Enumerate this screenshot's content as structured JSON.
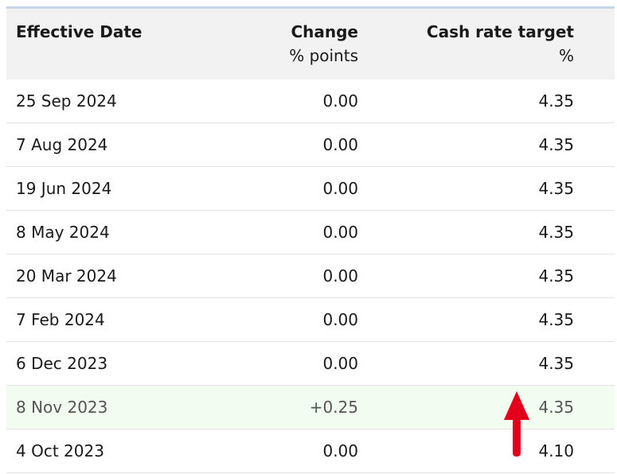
{
  "table": {
    "headers": {
      "date": "Effective Date",
      "change": "Change",
      "change_unit": "% points",
      "rate": "Cash rate target",
      "rate_unit": "%"
    },
    "rows": [
      {
        "date": "25 Sep 2024",
        "change": "0.00",
        "rate": "4.35"
      },
      {
        "date": "7 Aug 2024",
        "change": "0.00",
        "rate": "4.35"
      },
      {
        "date": "19 Jun 2024",
        "change": "0.00",
        "rate": "4.35"
      },
      {
        "date": "8 May 2024",
        "change": "0.00",
        "rate": "4.35"
      },
      {
        "date": "20 Mar 2024",
        "change": "0.00",
        "rate": "4.35"
      },
      {
        "date": "7 Feb 2024",
        "change": "0.00",
        "rate": "4.35"
      },
      {
        "date": "6 Dec 2023",
        "change": "0.00",
        "rate": "4.35"
      },
      {
        "date": "8 Nov 2023",
        "change": "+0.25",
        "rate": "4.35",
        "highlight": true
      },
      {
        "date": "4 Oct 2023",
        "change": "0.00",
        "rate": "4.10"
      }
    ]
  },
  "annotation": {
    "icon": "up-arrow-icon",
    "color": "#e3001b"
  },
  "colors": {
    "header_bg": "#f2f2f2",
    "highlight_bg": "#f3fcf1",
    "top_border": "#c6d7ea"
  }
}
